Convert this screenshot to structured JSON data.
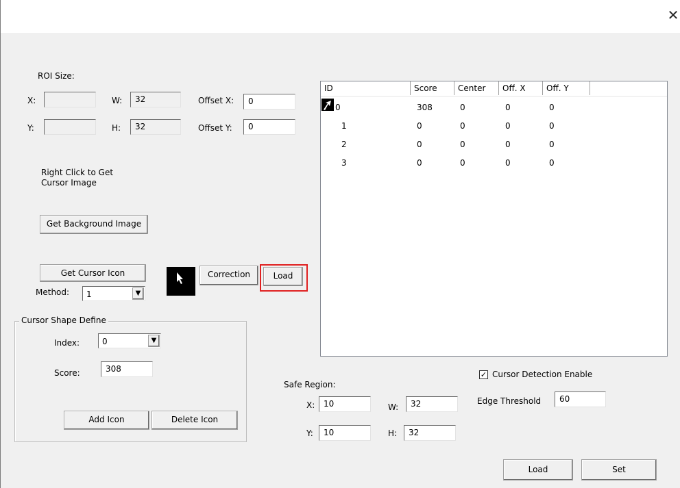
{
  "window": {
    "close_glyph": "✕"
  },
  "roi": {
    "title": "ROI Size:",
    "x_label": "X:",
    "x_value": "",
    "y_label": "Y:",
    "y_value": "",
    "w_label": "W:",
    "w_value": "32",
    "h_label": "H:",
    "h_value": "32",
    "offx_label": "Offset X:",
    "offx_value": "0",
    "offy_label": "Offset Y:",
    "offy_value": "0"
  },
  "hint": {
    "line1": "Right Click to Get",
    "line2": "Cursor Image"
  },
  "buttons": {
    "get_background": "Get Background Image",
    "get_cursor_icon": "Get Cursor Icon",
    "correction": "Correction",
    "load_top": "Load",
    "add_icon": "Add Icon",
    "delete_icon": "Delete Icon",
    "load_bottom": "Load",
    "set": "Set"
  },
  "method": {
    "label": "Method:",
    "value": "1"
  },
  "cursor_shape": {
    "title": "Cursor Shape Define",
    "index_label": "Index:",
    "index_value": "0",
    "score_label": "Score:",
    "score_value": "308"
  },
  "table": {
    "columns": [
      "ID",
      "Score",
      "Center",
      "Off. X",
      "Off. Y"
    ],
    "rows": [
      {
        "id": "0",
        "score": "308",
        "center": "0",
        "offx": "0",
        "offy": "0"
      },
      {
        "id": "1",
        "score": "0",
        "center": "0",
        "offx": "0",
        "offy": "0"
      },
      {
        "id": "2",
        "score": "0",
        "center": "0",
        "offx": "0",
        "offy": "0"
      },
      {
        "id": "3",
        "score": "0",
        "center": "0",
        "offx": "0",
        "offy": "0"
      }
    ]
  },
  "safe_region": {
    "title": "Safe Region:",
    "x_label": "X:",
    "x_value": "10",
    "y_label": "Y:",
    "y_value": "10",
    "w_label": "W:",
    "w_value": "32",
    "h_label": "H:",
    "h_value": "32"
  },
  "detection": {
    "enable_label": "Cursor Detection Enable",
    "enabled": true,
    "check_glyph": "✓"
  },
  "edge": {
    "label": "Edge Threshold",
    "value": "60"
  },
  "icons": {
    "close": "close-icon",
    "cursor_thumbnail": "cursor-arrow-icon",
    "dropdown": "chevron-down-icon",
    "dropdown_glyph": "▼"
  },
  "colors": {
    "highlight": "#e02020",
    "window_bg": "#f0f0f0"
  }
}
